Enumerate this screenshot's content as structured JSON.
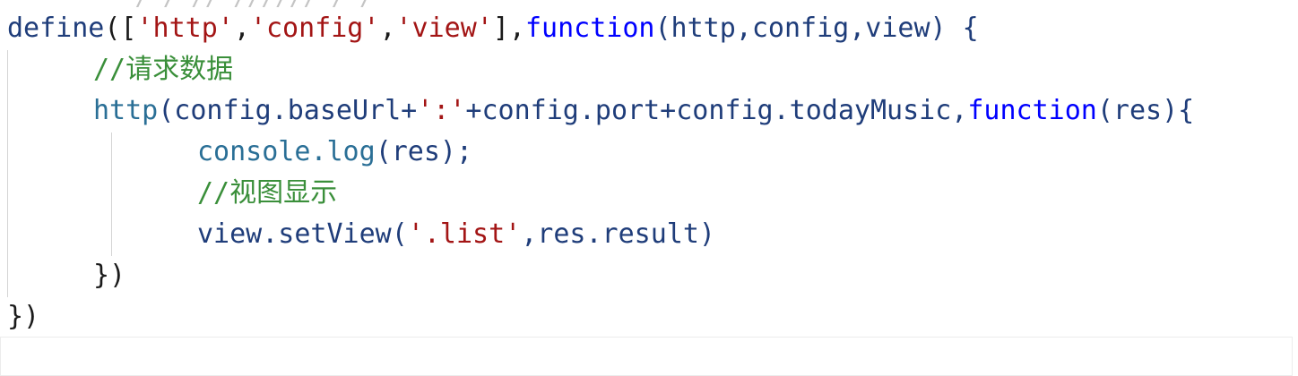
{
  "code": {
    "line1": {
      "define": "define",
      "open": "([",
      "s1": "'http'",
      "c1": ",",
      "s2": "'config'",
      "c2": ",",
      "s3": "'view'",
      "close_arr": "],",
      "function_kw": "function",
      "params": "(http,config,view) {"
    },
    "line2": {
      "comment": "//请求数据"
    },
    "line3": {
      "call": "http",
      "args_start": "(config.baseUrl+",
      "colon_str": "':'",
      "args_mid": "+config.port+config.todayMusic,",
      "function_kw": "function",
      "args_end": "(res){"
    },
    "line4": {
      "console": "console",
      "dot_log": ".log",
      "rest": "(res);"
    },
    "line5": {
      "comment": "//视图显示"
    },
    "line6": {
      "prefix": "view.setView(",
      "str": "'.list'",
      "suffix": ",res.result)"
    },
    "line7": {
      "text": "})"
    },
    "line8": {
      "text": "})"
    }
  },
  "colors": {
    "keyword": "#0000ff",
    "string": "#a31515",
    "comment": "#3a8f3a",
    "identifier": "#1f3d7a"
  }
}
